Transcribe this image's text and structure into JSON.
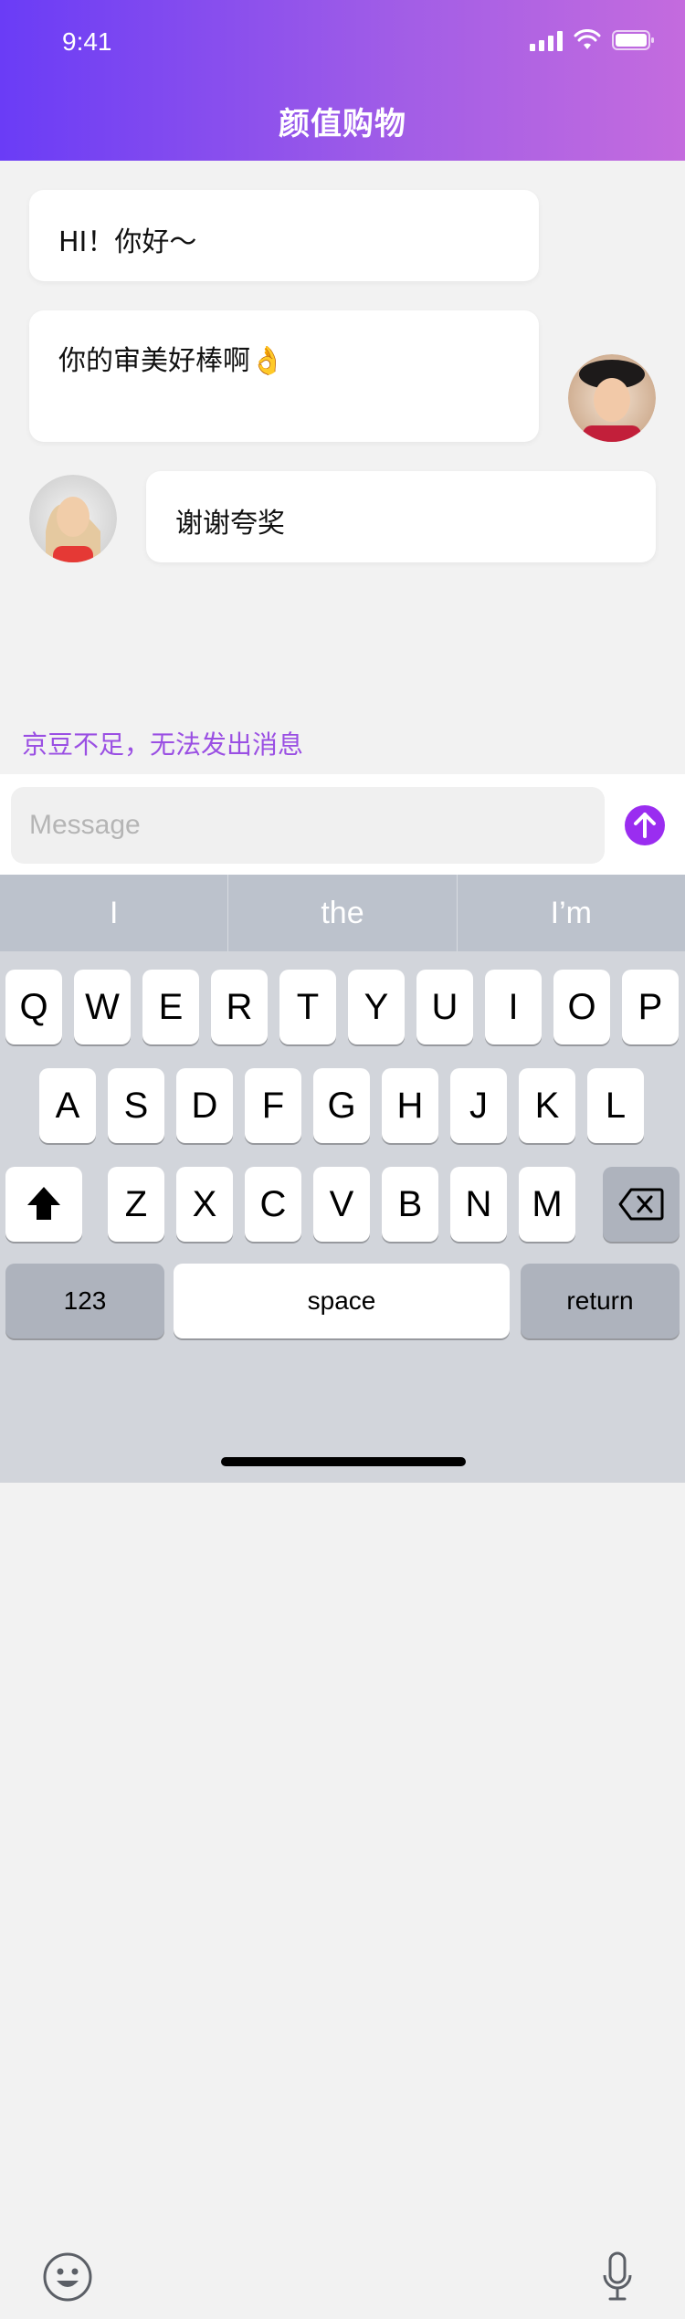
{
  "status_bar": {
    "time": "9:41"
  },
  "header": {
    "title": "颜值购物"
  },
  "chat": {
    "messages": [
      {
        "text": "HI！你好～"
      },
      {
        "text": "你的审美好棒啊👌"
      },
      {
        "text": "谢谢夸奖"
      }
    ],
    "notice": "京豆不足，无法发出消息"
  },
  "composer": {
    "placeholder": "Message"
  },
  "keyboard": {
    "suggestions": [
      "I",
      "the",
      "I’m"
    ],
    "row1": [
      "Q",
      "W",
      "E",
      "R",
      "T",
      "Y",
      "U",
      "I",
      "O",
      "P"
    ],
    "row2": [
      "A",
      "S",
      "D",
      "F",
      "G",
      "H",
      "J",
      "K",
      "L"
    ],
    "row3": [
      "Z",
      "X",
      "C",
      "V",
      "B",
      "N",
      "M"
    ],
    "numbers_label": "123",
    "space_label": "space",
    "return_label": "return"
  },
  "colors": {
    "header_gradient_start": "#6a3cf6",
    "header_gradient_end": "#c46bde",
    "accent": "#9a4fe3"
  },
  "icons": [
    "signal-icon",
    "wifi-icon",
    "battery-icon",
    "send-arrow-icon",
    "shift-icon",
    "backspace-icon",
    "emoji-icon",
    "microphone-icon"
  ]
}
